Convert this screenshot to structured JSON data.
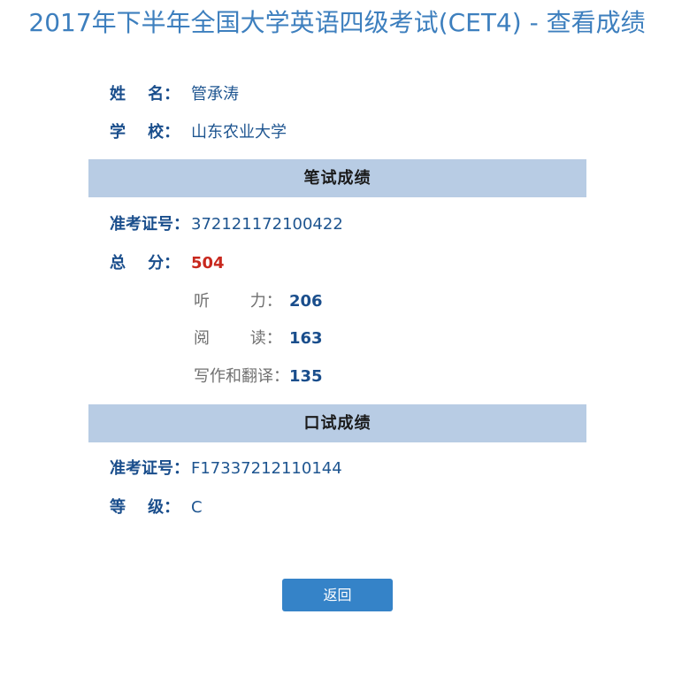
{
  "title": "2017年下半年全国大学英语四级考试(CET4) - 查看成绩",
  "info": {
    "name_label": "姓    名：",
    "name_value": "管承涛",
    "school_label": "学    校：",
    "school_value": "山东农业大学"
  },
  "written": {
    "section_title": "笔试成绩",
    "ticket_label": "准考证号：",
    "ticket_value": "372121172100422",
    "total_label": "总    分：",
    "total_value": "504",
    "listening_label": "听        力：",
    "listening_value": "206",
    "reading_label": "阅        读：",
    "reading_value": "163",
    "writing_label": "写作和翻译：",
    "writing_value": "135"
  },
  "oral": {
    "section_title": "口试成绩",
    "ticket_label": "准考证号：",
    "ticket_value": "F17337212110144",
    "grade_label": "等    级：",
    "grade_value": "C"
  },
  "back_button": "返回",
  "colors": {
    "title": "#3d7fbe",
    "label": "#1a4e8c",
    "total_score": "#c8281e",
    "section_band": "#b8cce4",
    "button": "#3583c8"
  }
}
